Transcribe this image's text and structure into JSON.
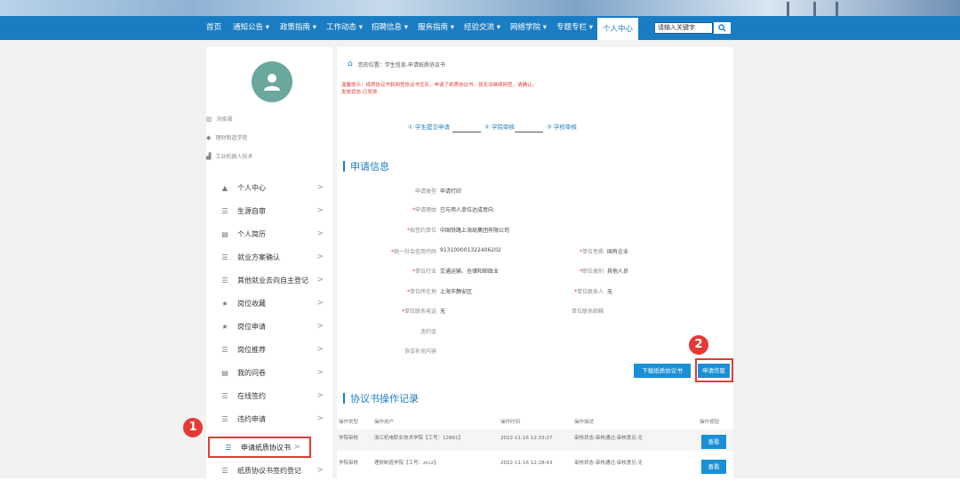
{
  "nav": {
    "items": [
      "首页",
      "通知公告 ▾",
      "政策指南 ▾",
      "工作动态 ▾",
      "招聘信息 ▾",
      "服务指南 ▾",
      "经验交流 ▾",
      "网络学院 ▾",
      "专题专栏 ▾",
      "个人中心"
    ],
    "search_placeholder": "请输入关键字"
  },
  "profile": {
    "name": "刘俊晨",
    "college": "理财制造学院",
    "major": "工业机器人技术"
  },
  "menu": [
    {
      "label": "个人中心",
      "icon": "person-icon"
    },
    {
      "label": "生源自审",
      "icon": "list-icon"
    },
    {
      "label": "个人简历",
      "icon": "doc-icon"
    },
    {
      "label": "就业方案确认",
      "icon": "list-icon"
    },
    {
      "label": "其他就业去向自主登记",
      "icon": "list-icon"
    },
    {
      "label": "岗位收藏",
      "icon": "star-icon"
    },
    {
      "label": "岗位申请",
      "icon": "star-icon"
    },
    {
      "label": "岗位推荐",
      "icon": "list-icon"
    },
    {
      "label": "我的问卷",
      "icon": "doc-icon"
    },
    {
      "label": "在线签约",
      "icon": "list-icon"
    },
    {
      "label": "违约申请",
      "icon": "list-icon"
    },
    {
      "label": "申请纸质协议书",
      "icon": "list-icon"
    },
    {
      "label": "纸质协议书签约登记",
      "icon": "list-icon"
    }
  ],
  "badges": {
    "one": "1",
    "two": "2"
  },
  "breadcrumb": "您的位置：学生信息-申请纸质协议书",
  "tip": {
    "line1": "温馨提示：纸质协议书和网签协议书互斥，申请了纸质协议书，就无法继续网签，请确认。",
    "line2": "发放状态:已发放"
  },
  "steps": [
    "① 学生提交申请",
    "② 学院审核",
    "③ 学校审核"
  ],
  "section1_title": "申请信息",
  "fields": {
    "apply_type": {
      "label": "申请类型",
      "value": "申请打印"
    },
    "reason": {
      "label": "申请理由",
      "value": "已与用人单位达成意向"
    },
    "unit": {
      "label": "拟签约单位",
      "value": "中国铁路上海局集团有限公司"
    },
    "credit_code": {
      "label": "统一社会信用代码",
      "value": "91310000132240620​2"
    },
    "unit_nature": {
      "label": "单位性质",
      "value": "国有企业"
    },
    "industry": {
      "label": "单位行业",
      "value": "交通运输、仓储和邮政业"
    },
    "position_type": {
      "label": "职位类别",
      "value": "其他人员"
    },
    "location": {
      "label": "单位所在地",
      "value": "上海市静安区"
    },
    "contact": {
      "label": "单位联系人",
      "value": "无"
    },
    "phone": {
      "label": "单位联系电话",
      "value": "无"
    },
    "email": {
      "label": "单位联系邮箱",
      "value": ""
    },
    "penalty": {
      "label": "违约金",
      "value": ""
    },
    "supplement": {
      "label": "协议补充内容",
      "value": ""
    }
  },
  "buttons": {
    "download": "下载纸质协议书",
    "cancel": "申请作废",
    "view": "查看"
  },
  "section2_title": "协议书操作记录",
  "table": {
    "headers": [
      "操作类型",
      "操作用户",
      "操作时间",
      "操作描述",
      "操作按钮"
    ],
    "rows": [
      [
        "学院审核",
        "浙江机电职业技术学院【工号：12861】",
        "2022-11-16 12:33:27",
        "审核状态:审核通过;审核意见:无"
      ],
      [
        "学院审核",
        "理财制造学院【工号：zccz】",
        "2022-11-16 12:28:43",
        "审核状态:审核通过;审核意见:无"
      ]
    ]
  }
}
